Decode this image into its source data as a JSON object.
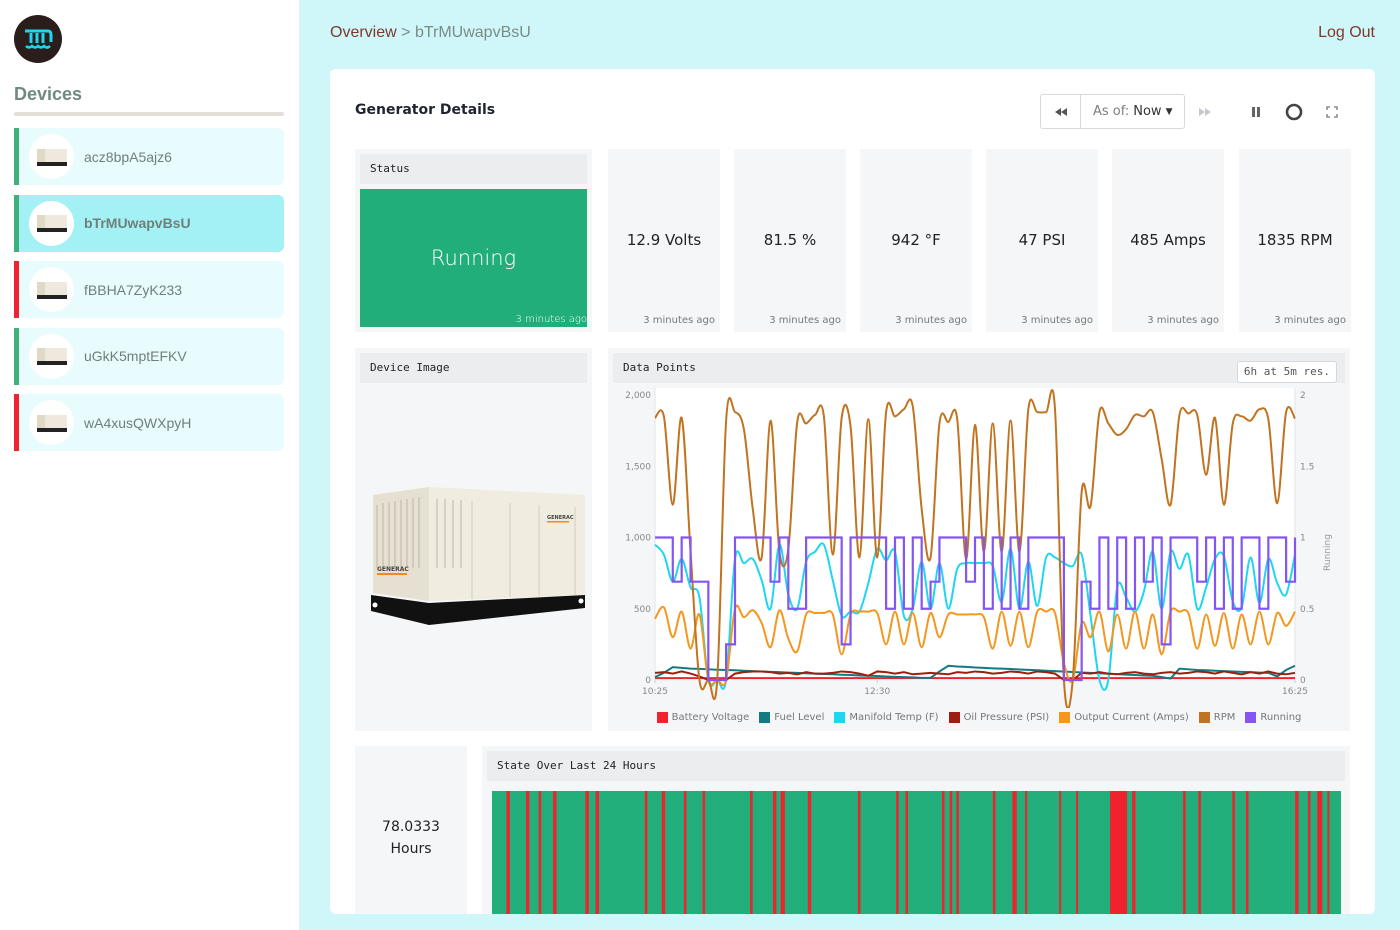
{
  "sidebar": {
    "title": "Devices",
    "devices": [
      {
        "name": "acz8bpA5ajz6",
        "status_color": "#3fb07a",
        "active": false
      },
      {
        "name": "bTrMUwapvBsU",
        "status_color": "#3fb07a",
        "active": true
      },
      {
        "name": "fBBHA7ZyK233",
        "status_color": "#f0222e",
        "active": false
      },
      {
        "name": "uGkK5mptEFKV",
        "status_color": "#3fb07a",
        "active": false
      },
      {
        "name": "wA4xusQWXpyH",
        "status_color": "#f0222e",
        "active": false
      }
    ]
  },
  "header": {
    "breadcrumb_root": "Overview",
    "breadcrumb_sep": ">",
    "breadcrumb_current": "bTrMUwapvBsU",
    "logout": "Log Out"
  },
  "card": {
    "title": "Generator Details",
    "toolbar": {
      "rewind_icon": "◂◂",
      "asof_label": "As of:",
      "asof_value": "Now",
      "forward_icon": "▸▸",
      "pause_icon": "pause-icon",
      "refresh_icon": "circle-icon",
      "fullscreen_icon": "fullscreen-icon"
    }
  },
  "status": {
    "title": "Status",
    "value": "Running",
    "updated": "3 minutes ago",
    "color": "#22ae7a"
  },
  "metrics": [
    {
      "value": "12.9 Volts",
      "updated": "3 minutes ago"
    },
    {
      "value": "81.5 %",
      "updated": "3 minutes ago"
    },
    {
      "value": "942 °F",
      "updated": "3 minutes ago"
    },
    {
      "value": "47 PSI",
      "updated": "3 minutes ago"
    },
    {
      "value": "485 Amps",
      "updated": "3 minutes ago"
    },
    {
      "value": "1835 RPM",
      "updated": "3 minutes ago"
    }
  ],
  "device_image": {
    "title": "Device Image",
    "brand": "GENERAC"
  },
  "data_points": {
    "title": "Data Points",
    "resolution": "6h at 5m res."
  },
  "chart_data": {
    "type": "line",
    "title": "Data Points",
    "x_ticks": [
      "10:25",
      "12:30",
      "16:25"
    ],
    "x_range": [
      "10:25",
      "16:25"
    ],
    "x_step_minutes": 5,
    "y_left": {
      "min": 0,
      "max": 2000,
      "ticks": [
        "0",
        "500",
        "1,000",
        "1,500",
        "2,000"
      ]
    },
    "y_right": {
      "label": "Running",
      "min": 0,
      "max": 2,
      "ticks": [
        "0",
        "0.5",
        "1",
        "1.5",
        "2"
      ]
    },
    "grid": false,
    "legend_position": "bottom",
    "series": [
      {
        "name": "Battery Voltage",
        "color": "#f0222e",
        "axis": "left",
        "values": [
          13,
          13,
          13,
          13,
          13,
          13,
          13,
          13,
          13,
          13,
          13,
          13,
          13,
          13,
          13,
          13,
          13,
          13,
          13,
          13,
          13,
          13,
          13,
          13,
          13,
          13,
          13,
          13,
          13,
          13,
          13,
          13,
          13,
          13,
          13,
          13,
          13,
          13,
          13,
          13,
          13,
          13,
          13,
          13,
          13,
          13,
          13,
          13,
          13,
          13,
          13,
          13,
          13,
          13,
          13,
          13,
          13,
          13,
          13,
          13,
          13,
          13,
          13,
          13,
          13,
          13,
          13,
          13,
          13,
          13,
          13,
          13,
          13
        ]
      },
      {
        "name": "Fuel Level",
        "color": "#117a82",
        "axis": "left",
        "values": [
          20,
          50,
          90,
          85,
          80,
          78,
          75,
          72,
          70,
          68,
          65,
          62,
          60,
          57,
          55,
          52,
          50,
          47,
          45,
          42,
          40,
          37,
          35,
          32,
          30,
          28,
          25,
          22,
          20,
          18,
          15,
          15,
          60,
          100,
          95,
          92,
          88,
          85,
          82,
          80,
          77,
          74,
          71,
          68,
          65,
          62,
          59,
          56,
          53,
          50,
          47,
          44,
          41,
          38,
          35,
          32,
          30,
          20,
          10,
          80,
          75,
          70,
          68,
          65,
          62,
          60,
          57,
          55,
          52,
          50,
          25,
          70,
          100
        ]
      },
      {
        "name": "Manifold Temp (F)",
        "color": "#1fd6f0",
        "axis": "left",
        "values": [
          950,
          880,
          690,
          850,
          650,
          580,
          0,
          0,
          0,
          850,
          820,
          850,
          700,
          500,
          950,
          600,
          500,
          830,
          900,
          950,
          700,
          450,
          480,
          480,
          680,
          920,
          840,
          900,
          450,
          500,
          830,
          500,
          820,
          500,
          780,
          820,
          820,
          820,
          800,
          550,
          920,
          500,
          830,
          520,
          860,
          860,
          820,
          800,
          880,
          450,
          0,
          0,
          650,
          580,
          480,
          620,
          900,
          500,
          900,
          780,
          880,
          500,
          650,
          850,
          870,
          550,
          510,
          860,
          540,
          850,
          680,
          600,
          880
        ]
      },
      {
        "name": "Oil Pressure (PSI)",
        "color": "#9e1f12",
        "axis": "left",
        "values": [
          50,
          55,
          45,
          60,
          45,
          25,
          0,
          0,
          0,
          45,
          55,
          60,
          60,
          55,
          45,
          50,
          40,
          55,
          45,
          45,
          50,
          60,
          55,
          45,
          30,
          60,
          55,
          45,
          55,
          40,
          45,
          50,
          45,
          40,
          55,
          50,
          60,
          55,
          45,
          50,
          60,
          55,
          45,
          60,
          55,
          45,
          0,
          0,
          50,
          45,
          55,
          45,
          40,
          50,
          55,
          45,
          40,
          50,
          55,
          45,
          50,
          60,
          55,
          45,
          60,
          50,
          40,
          55,
          45,
          60,
          45,
          40,
          50
        ]
      },
      {
        "name": "Output Current (Amps)",
        "color": "#f5961e",
        "axis": "left",
        "values": [
          430,
          510,
          300,
          480,
          220,
          460,
          0,
          0,
          0,
          500,
          440,
          490,
          400,
          230,
          490,
          290,
          200,
          460,
          470,
          470,
          460,
          180,
          460,
          480,
          480,
          470,
          250,
          480,
          250,
          470,
          230,
          470,
          300,
          460,
          460,
          460,
          460,
          440,
          220,
          480,
          240,
          480,
          230,
          480,
          480,
          470,
          120,
          0,
          400,
          300,
          480,
          200,
          460,
          220,
          480,
          220,
          460,
          180,
          480,
          480,
          470,
          220,
          460,
          240,
          470,
          220,
          460,
          250,
          480,
          250,
          470,
          380,
          480
        ]
      },
      {
        "name": "RPM",
        "color": "#c27320",
        "axis": "left",
        "values": [
          1840,
          1850,
          1230,
          1840,
          900,
          0,
          0,
          0,
          1820,
          1880,
          1760,
          1200,
          860,
          1820,
          900,
          920,
          1810,
          1800,
          1860,
          1850,
          880,
          1840,
          1780,
          860,
          1830,
          860,
          1880,
          1850,
          1900,
          1920,
          1200,
          860,
          1800,
          1810,
          1830,
          850,
          1790,
          900,
          1800,
          900,
          1820,
          900,
          1900,
          1880,
          1880,
          1900,
          0,
          0,
          1320,
          1220,
          1880,
          1800,
          1720,
          1760,
          1860,
          1850,
          1880,
          1550,
          1230,
          1860,
          1870,
          1860,
          1440,
          1840,
          1230,
          1800,
          1850,
          1820,
          1900,
          1830,
          1240,
          1880,
          1835
        ]
      },
      {
        "name": "Running",
        "color": "#8455f2",
        "axis": "right",
        "values": [
          1,
          1,
          0.69,
          1,
          0.69,
          0.69,
          0,
          0,
          0.25,
          1,
          1,
          1,
          1,
          0.69,
          1,
          0.5,
          0.5,
          1,
          1,
          1,
          1,
          0.25,
          1,
          1,
          1,
          1,
          0.5,
          1,
          0.5,
          1,
          0.5,
          0.69,
          1,
          1,
          1,
          0.69,
          1,
          0.5,
          1,
          0.5,
          1,
          0.5,
          1,
          1,
          1,
          1,
          0,
          0,
          0.69,
          0.5,
          1,
          0.5,
          1,
          0.5,
          1,
          0.69,
          1,
          0.25,
          1,
          1,
          1,
          0.69,
          1,
          0.5,
          1,
          0.5,
          1,
          1,
          0.5,
          1,
          1,
          0.69,
          1
        ]
      }
    ]
  },
  "run_hours": {
    "value": "78.0333",
    "unit": "Hours"
  },
  "state_24h": {
    "title": "State Over Last 24 Hours",
    "on_color": "#22ae7a",
    "off_color": "#f0222e",
    "off_segments": [
      [
        0.017,
        0.021
      ],
      [
        0.04,
        0.044
      ],
      [
        0.055,
        0.058
      ],
      [
        0.072,
        0.076
      ],
      [
        0.11,
        0.114
      ],
      [
        0.122,
        0.126
      ],
      [
        0.18,
        0.183
      ],
      [
        0.2,
        0.204
      ],
      [
        0.226,
        0.229
      ],
      [
        0.248,
        0.251
      ],
      [
        0.304,
        0.307
      ],
      [
        0.331,
        0.335
      ],
      [
        0.34,
        0.345
      ],
      [
        0.372,
        0.376
      ],
      [
        0.431,
        0.434
      ],
      [
        0.476,
        0.479
      ],
      [
        0.487,
        0.49
      ],
      [
        0.53,
        0.533
      ],
      [
        0.539,
        0.542
      ],
      [
        0.547,
        0.55
      ],
      [
        0.59,
        0.593
      ],
      [
        0.613,
        0.618
      ],
      [
        0.628,
        0.63
      ],
      [
        0.668,
        0.67
      ],
      [
        0.688,
        0.69
      ],
      [
        0.728,
        0.748
      ],
      [
        0.754,
        0.758
      ],
      [
        0.814,
        0.817
      ],
      [
        0.832,
        0.835
      ],
      [
        0.872,
        0.875
      ],
      [
        0.888,
        0.891
      ],
      [
        0.946,
        0.95
      ],
      [
        0.961,
        0.964
      ],
      [
        0.972,
        0.978
      ],
      [
        0.984,
        0.986
      ],
      [
        1.0,
        1.0
      ]
    ]
  }
}
